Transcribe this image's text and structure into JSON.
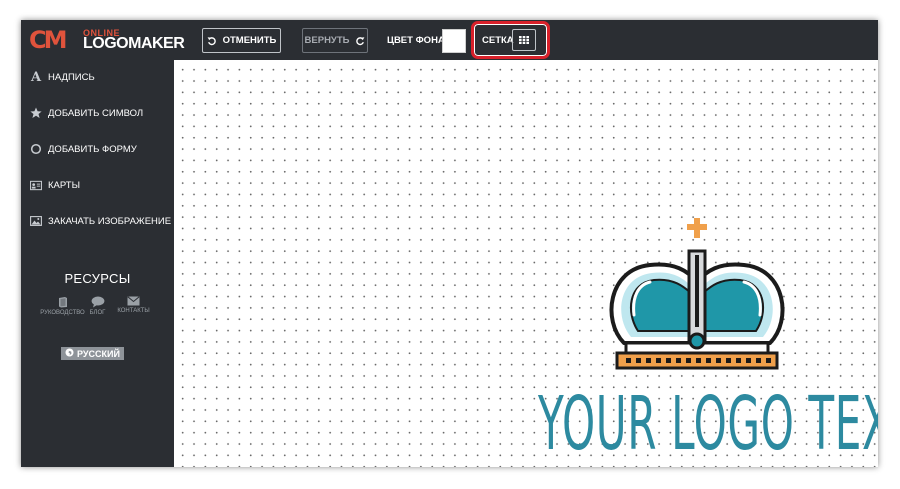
{
  "app": {
    "logo": {
      "brand_mark": "CM",
      "online": "ONLINE",
      "name": "LOGOMAKER"
    }
  },
  "toolbar": {
    "undo_label": "ОТМЕНИТЬ",
    "redo_label": "ВЕРНУТЬ",
    "bgcolor_label": "ЦВЕТ ФОНА",
    "bgcolor_value": "#ffffff",
    "grid_label": "СЕТКА",
    "highlight_color": "#d8202a"
  },
  "sidebar": {
    "items": [
      {
        "label": "НАДПИСЬ",
        "icon": "text-icon"
      },
      {
        "label": "ДОБАВИТЬ СИМВОЛ",
        "icon": "star-icon"
      },
      {
        "label": "ДОБАВИТЬ ФОРМУ",
        "icon": "circle-icon"
      },
      {
        "label": "КАРТЫ",
        "icon": "map-card-icon"
      },
      {
        "label": "ЗАКАЧАТЬ ИЗОБРАЖЕНИЕ",
        "icon": "image-icon"
      }
    ],
    "resources_title": "РЕСУРСЫ",
    "resources": [
      {
        "label": "РУКОВОДСТВО",
        "icon": "book-icon"
      },
      {
        "label": "БЛОГ",
        "icon": "chat-icon"
      },
      {
        "label": "КОНТАКТЫ",
        "icon": "envelope-icon"
      }
    ],
    "language": "РУССКИЙ"
  },
  "canvas": {
    "grid_visible": true,
    "logo_text": "YOUR LOGO TEXT",
    "logo_text_color": "#2d8aa0",
    "crown_colors": {
      "outline": "#1b1b1b",
      "fill": "#1f97a8",
      "cross": "#f0a04b",
      "band": "#f0a04b"
    }
  },
  "colors": {
    "toolbar_bg": "#2b2e33",
    "accent": "#e0533c"
  }
}
